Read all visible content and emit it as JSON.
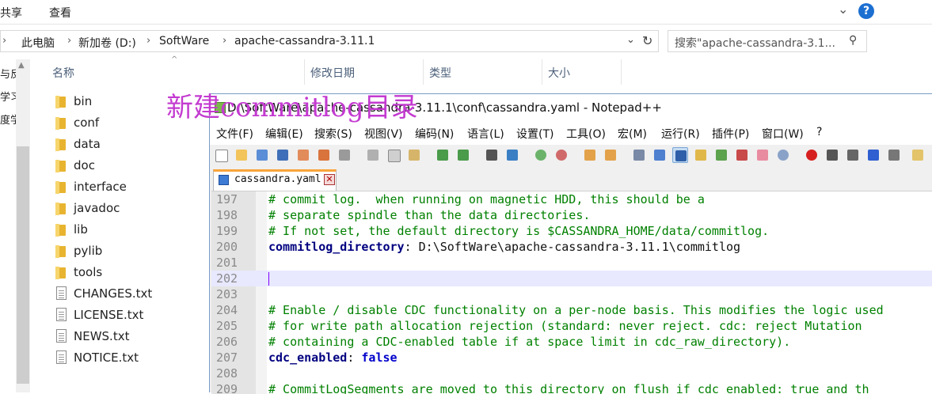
{
  "explorer": {
    "ribbon_tabs": [
      "共享",
      "查看"
    ],
    "breadcrumb": [
      "此电脑",
      "新加卷 (D:)",
      "SoftWare",
      "apache-cassandra-3.11.1"
    ],
    "search_placeholder": "搜索\"apache-cassandra-3.1...",
    "nav_items": [
      "与反",
      "学习",
      "度学"
    ],
    "columns": [
      "名称",
      "修改日期",
      "类型",
      "大小"
    ],
    "files": [
      {
        "name": "bin",
        "kind": "folder"
      },
      {
        "name": "conf",
        "kind": "folder"
      },
      {
        "name": "data",
        "kind": "folder"
      },
      {
        "name": "doc",
        "kind": "folder"
      },
      {
        "name": "interface",
        "kind": "folder"
      },
      {
        "name": "javadoc",
        "kind": "folder"
      },
      {
        "name": "lib",
        "kind": "folder"
      },
      {
        "name": "pylib",
        "kind": "folder"
      },
      {
        "name": "tools",
        "kind": "folder"
      },
      {
        "name": "CHANGES.txt",
        "kind": "text"
      },
      {
        "name": "LICENSE.txt",
        "kind": "text"
      },
      {
        "name": "NEWS.txt",
        "kind": "text"
      },
      {
        "name": "NOTICE.txt",
        "kind": "text"
      }
    ]
  },
  "annotation": "新建commitlog目录",
  "notepad": {
    "title": "D:\\SoftWare\\apache-cassandra-3.11.1\\conf\\cassandra.yaml - Notepad++",
    "menus": [
      "文件(F)",
      "编辑(E)",
      "搜索(S)",
      "视图(V)",
      "编码(N)",
      "语言(L)",
      "设置(T)",
      "工具(O)",
      "宏(M)",
      "运行(R)",
      "插件(P)",
      "窗口(W)",
      "?"
    ],
    "tab_name": "cassandra.yaml",
    "current_line": "202",
    "lines": [
      {
        "n": "197",
        "type": "comment",
        "text": "# commit log.  when running on magnetic HDD, this should be a"
      },
      {
        "n": "198",
        "type": "comment",
        "text": "# separate spindle than the data directories."
      },
      {
        "n": "199",
        "type": "comment",
        "text": "# If not set, the default directory is $CASSANDRA_HOME/data/commitlog."
      },
      {
        "n": "200",
        "type": "kv",
        "key": "commitlog_directory",
        "sep": ": ",
        "value": "D:\\SoftWare\\apache-cassandra-3.11.1\\commitlog"
      },
      {
        "n": "201",
        "type": "blank",
        "text": ""
      },
      {
        "n": "202",
        "type": "blank",
        "text": ""
      },
      {
        "n": "203",
        "type": "blank",
        "text": ""
      },
      {
        "n": "204",
        "type": "comment",
        "text": "# Enable / disable CDC functionality on a per-node basis. This modifies the logic used"
      },
      {
        "n": "205",
        "type": "comment",
        "text": "# for write path allocation rejection (standard: never reject. cdc: reject Mutation"
      },
      {
        "n": "206",
        "type": "comment",
        "text": "# containing a CDC-enabled table if at space limit in cdc_raw_directory)."
      },
      {
        "n": "207",
        "type": "kvbool",
        "key": "cdc_enabled",
        "sep": ": ",
        "value": "false"
      },
      {
        "n": "208",
        "type": "blank",
        "text": ""
      },
      {
        "n": "209",
        "type": "comment",
        "text": "# CommitLogSegments are moved to this directory on flush if cdc_enabled: true and th"
      }
    ]
  }
}
